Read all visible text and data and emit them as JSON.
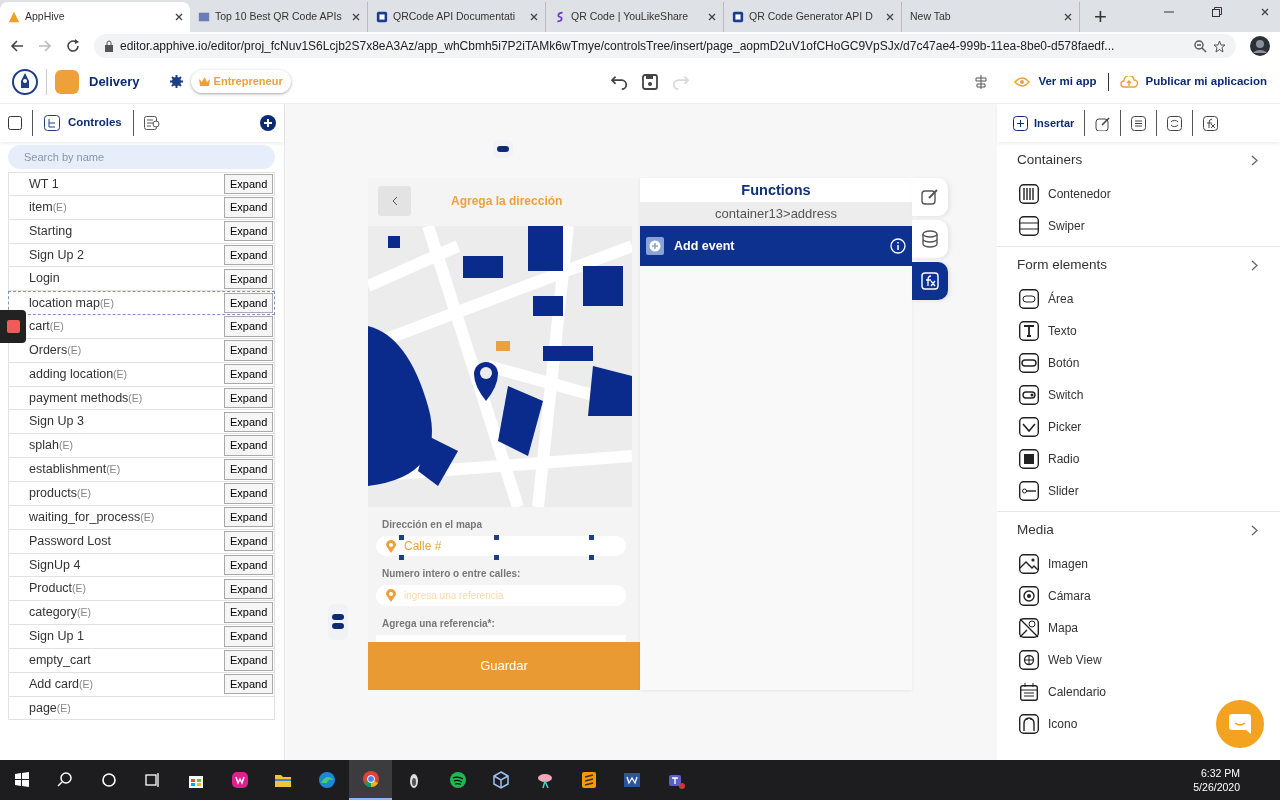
{
  "browser": {
    "tabs": [
      {
        "title": "AppHive",
        "selected": true
      },
      {
        "title": "Top 10 Best QR Code APIs",
        "selected": false
      },
      {
        "title": "QRCode API Documentati",
        "selected": false
      },
      {
        "title": "QR Code | YouLikeShare",
        "selected": false
      },
      {
        "title": "QR Code Generator API D",
        "selected": false
      },
      {
        "title": "New Tab",
        "selected": false
      }
    ],
    "new_tab": "+",
    "url": "editor.apphive.io/editor/proj_fcNuv1S6Lcjb2S7x8eA3Az/app_whCbmh5i7P2iTAMk6wTmye/controlsTree/insert/page_aopmD2uV1ofCHoGC9VpSJx/d7c47ae4-999b-11ea-8be0-d578faedf..."
  },
  "app_header": {
    "project": "Delivery",
    "plan": "Entrepreneur",
    "history": [
      {
        "disabled": false
      },
      {
        "disabled": false
      },
      {
        "disabled": true
      }
    ],
    "view_app": "Ver mi app",
    "publish": "Publicar mi aplicacion"
  },
  "left_panel": {
    "select_all": {
      "checked": false
    },
    "tab": "Controles",
    "search": {
      "placeholder": "Search by name"
    },
    "screens": [
      {
        "name": "WT 1",
        "expand": "Expand",
        "selected": false
      },
      {
        "name": "item",
        "tag": "(E)",
        "expand": "Expand",
        "selected": false
      },
      {
        "name": "Starting",
        "expand": "Expand",
        "selected": false
      },
      {
        "name": "Sign Up 2",
        "expand": "Expand",
        "selected": false
      },
      {
        "name": "Login",
        "expand": "Expand",
        "selected": false
      },
      {
        "name": "location map",
        "tag": "(E)",
        "expand": "Expand",
        "selected": true
      },
      {
        "name": "cart",
        "tag": "(E)",
        "expand": "Expand",
        "selected": false
      },
      {
        "name": "Orders",
        "tag": "(E)",
        "expand": "Expand",
        "selected": false
      },
      {
        "name": "adding location",
        "tag": "(E)",
        "expand": "Expand",
        "selected": false
      },
      {
        "name": "payment methods",
        "tag": "(E)",
        "expand": "Expand",
        "selected": false
      },
      {
        "name": "Sign Up 3",
        "expand": "Expand",
        "selected": false
      },
      {
        "name": "splah",
        "tag": "(E)",
        "expand": "Expand",
        "selected": false
      },
      {
        "name": "establishment",
        "tag": "(E)",
        "expand": "Expand",
        "selected": false
      },
      {
        "name": "products",
        "tag": "(E)",
        "expand": "Expand",
        "selected": false
      },
      {
        "name": "waiting_for_process",
        "tag": "(E)",
        "expand": "Expand",
        "selected": false
      },
      {
        "name": "Password Lost",
        "expand": "Expand",
        "selected": false
      },
      {
        "name": "SignUp 4",
        "expand": "Expand",
        "selected": false
      },
      {
        "name": "Product",
        "tag": "(E)",
        "expand": "Expand",
        "selected": false
      },
      {
        "name": "category",
        "tag": "(E)",
        "expand": "Expand",
        "selected": false
      },
      {
        "name": "Sign Up 1",
        "expand": "Expand",
        "selected": false
      },
      {
        "name": "empty_cart",
        "expand": "Expand",
        "selected": false
      },
      {
        "name": "Add card",
        "tag": "(E)",
        "expand": "Expand",
        "selected": false
      },
      {
        "name": "page",
        "tag": "(E)",
        "selected": false
      }
    ]
  },
  "phone": {
    "title": "Agrega la dirección",
    "fields": [
      {
        "label": "Dirección en el mapa",
        "placeholder": "Calle #",
        "selected": true
      },
      {
        "label": "Numero intero o entre calles:",
        "placeholder": "ingresa una referencia",
        "selected": false
      },
      {
        "label": "Agrega una referencia*:",
        "selected": false
      }
    ],
    "button": "Guardar"
  },
  "functions": {
    "title": "Functions",
    "path": "container13>address",
    "add_event": "Add event",
    "side_tabs": [
      {
        "selected": false
      },
      {
        "selected": false
      },
      {
        "selected": true
      }
    ]
  },
  "right_panel": {
    "tabs": [
      {
        "label": "Insertar",
        "selected": true
      },
      {
        "selected": false
      },
      {
        "selected": false
      },
      {
        "selected": false
      },
      {
        "selected": false
      }
    ],
    "sections": [
      {
        "title": "Containers",
        "items": [
          "Contenedor",
          "Swiper"
        ]
      },
      {
        "title": "Form elements",
        "items": [
          "Área",
          "Texto",
          "Botón",
          "Switch",
          "Picker",
          "Radio",
          "Slider"
        ]
      },
      {
        "title": "Media",
        "items": [
          "Imagen",
          "Cámara",
          "Mapa",
          "Web View",
          "Calendario",
          "Icono"
        ]
      }
    ]
  },
  "taskbar": {
    "buttons": [
      {
        "selected": false
      },
      {
        "selected": false
      },
      {
        "selected": false
      },
      {
        "selected": false
      },
      {
        "selected": false
      },
      {
        "selected": false
      },
      {
        "selected": false
      },
      {
        "selected": false
      },
      {
        "selected": true
      },
      {
        "selected": false
      },
      {
        "selected": false
      },
      {
        "selected": false
      },
      {
        "selected": false
      },
      {
        "selected": false
      },
      {
        "selected": false
      },
      {
        "selected": false
      }
    ],
    "time": "6:32 PM",
    "date": "5/26/2020"
  }
}
